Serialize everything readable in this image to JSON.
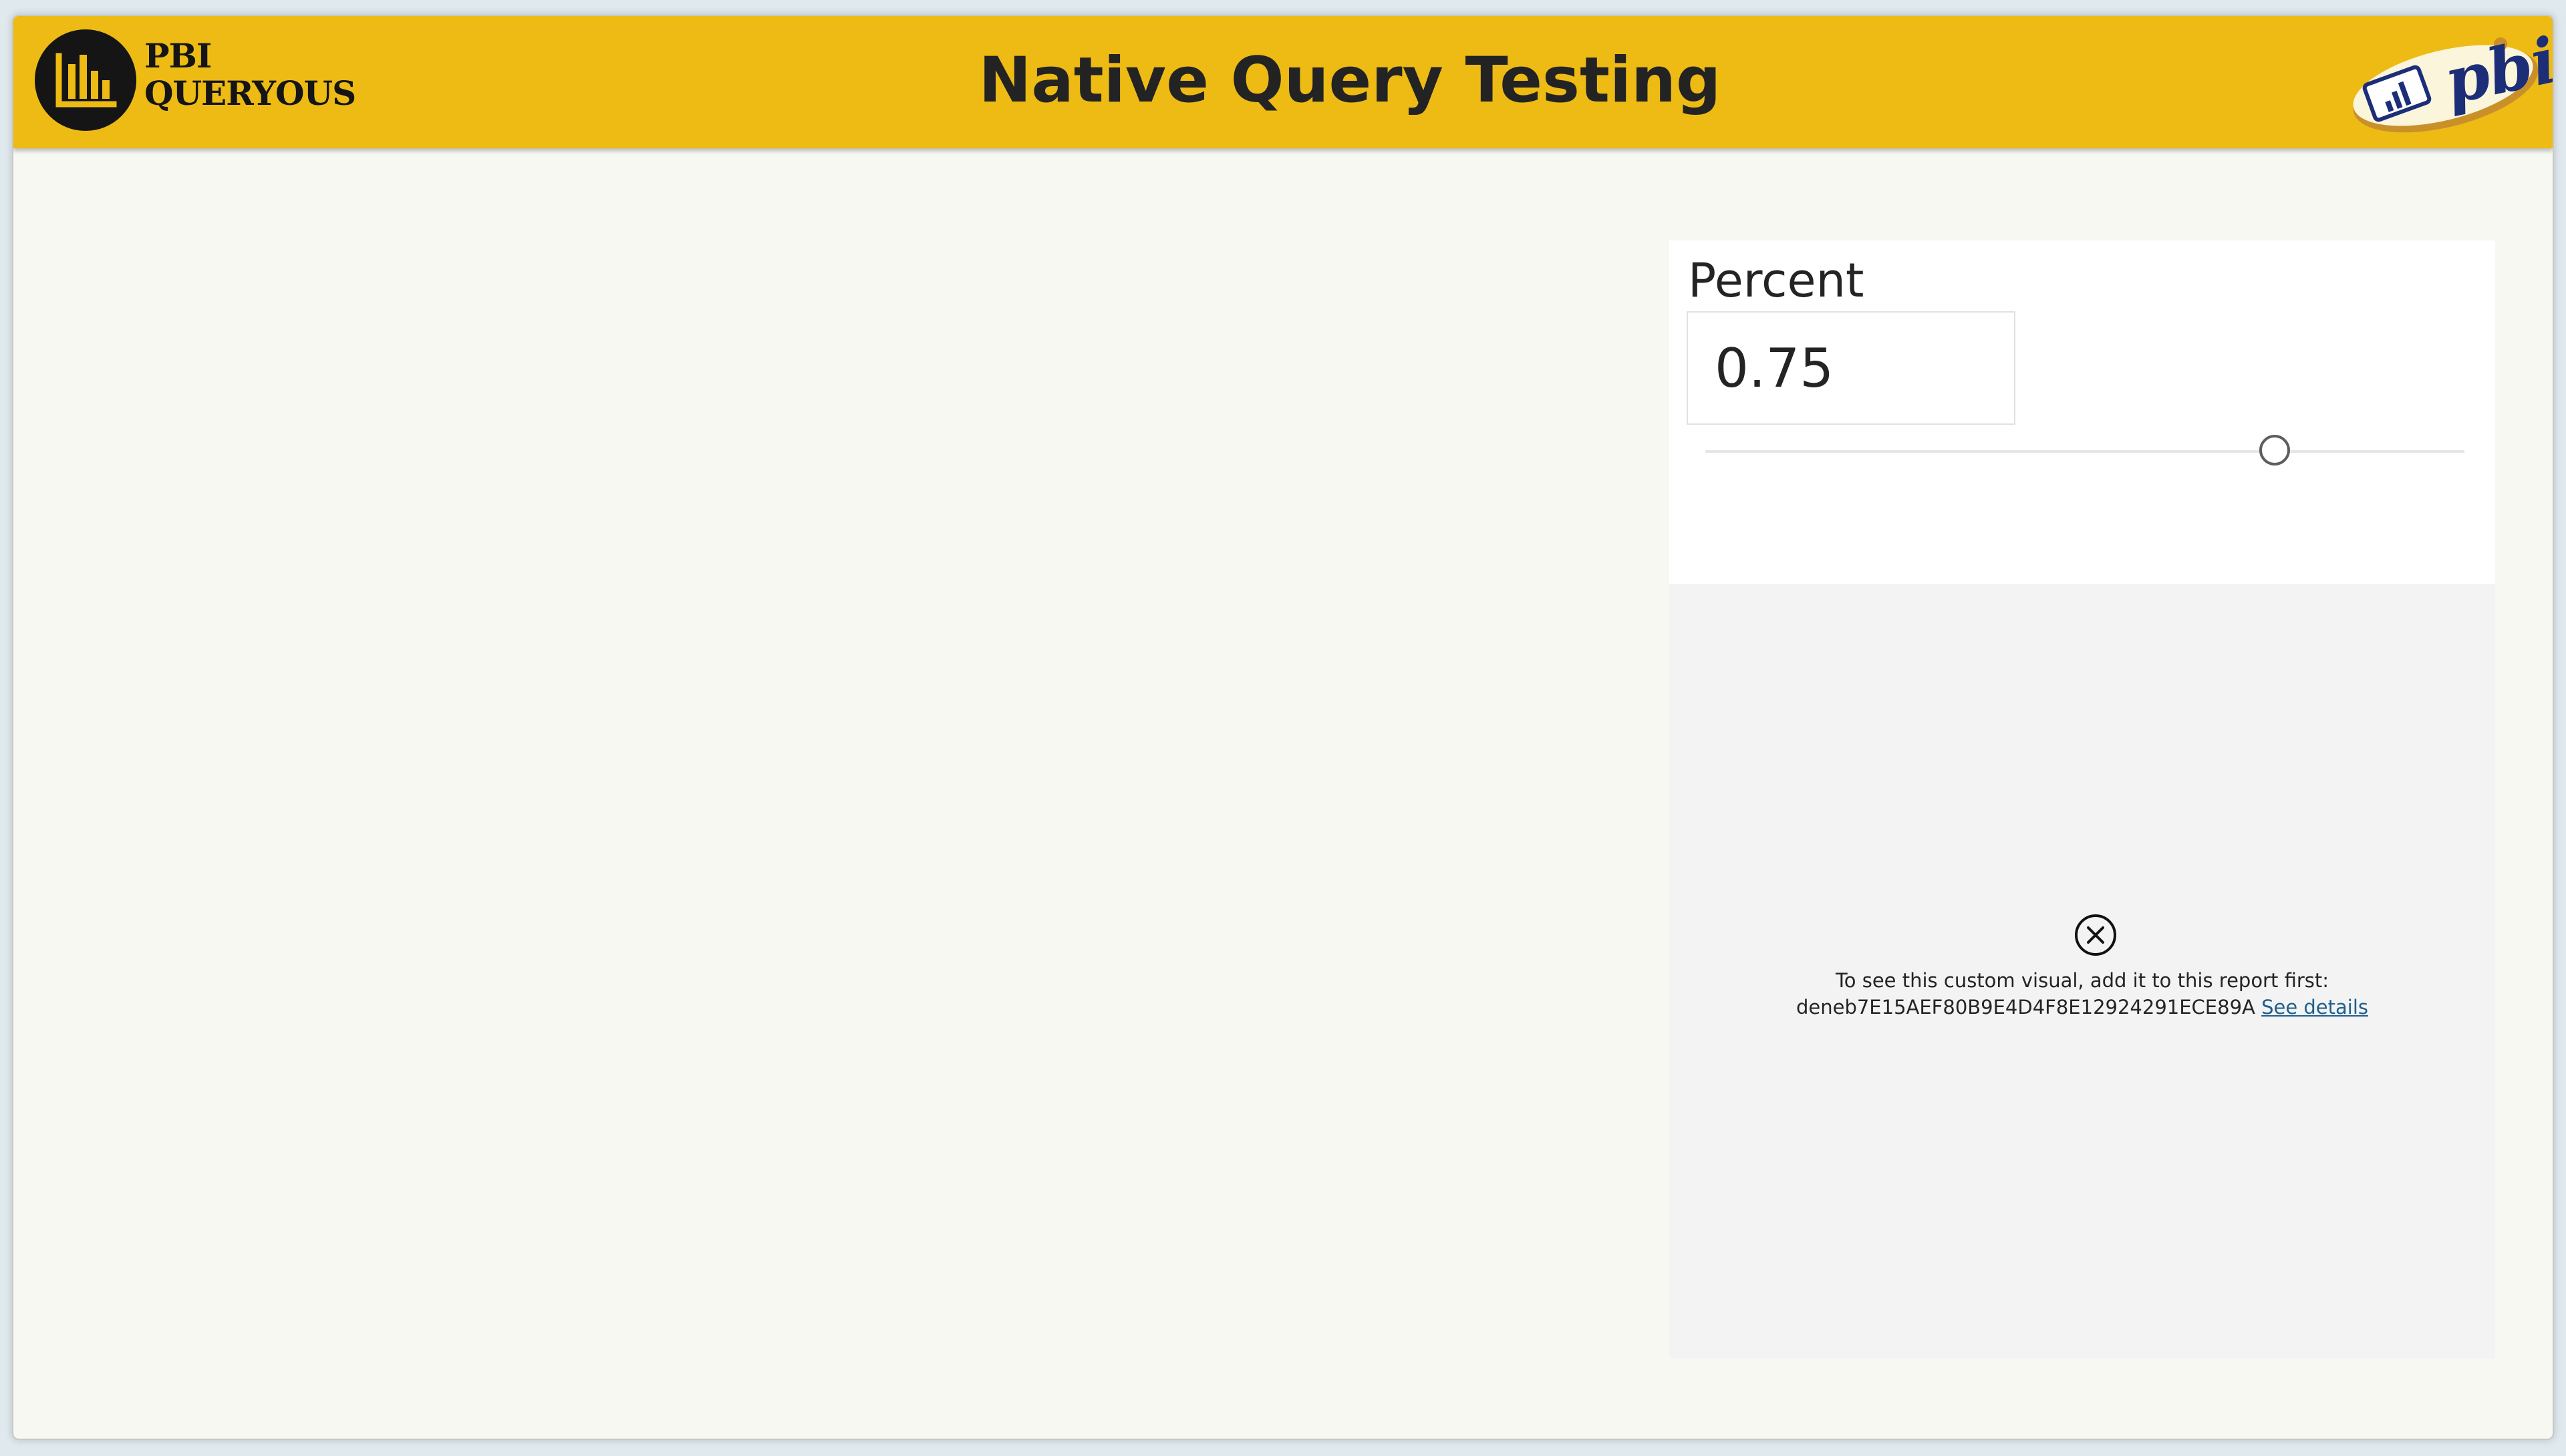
{
  "header": {
    "title": "Native Query Testing",
    "logo_left_line1": "PBI",
    "logo_left_line2": "QUERYOUS",
    "logo_right_text": "pbix",
    "background_color": "#edbb14"
  },
  "slicer": {
    "title": "Percent",
    "value": "0.75",
    "slider_value": 0.75
  },
  "custom_visual": {
    "icon": "close-circle-icon",
    "message": "To see this custom visual, add it to this report first:",
    "visual_id": "deneb7E15AEF80B9E4D4F8E12924291ECE89A",
    "link_label": "See details"
  }
}
